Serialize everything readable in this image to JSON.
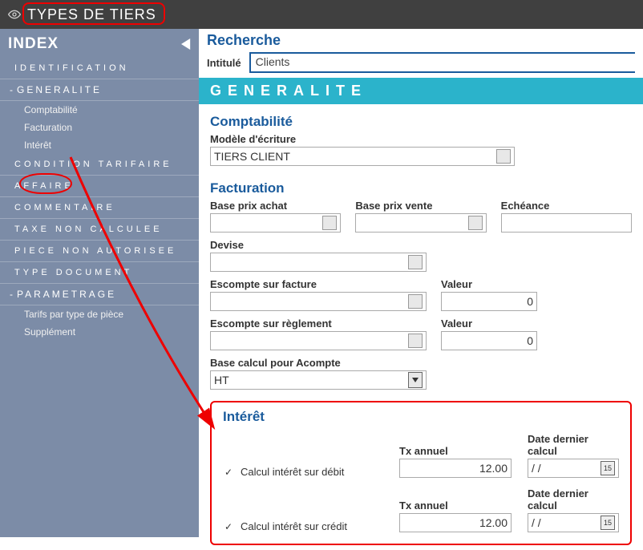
{
  "header": {
    "title": "TYPES DE TIERS"
  },
  "sidebar": {
    "index_label": "INDEX",
    "groups": [
      {
        "label": "IDENTIFICATION"
      }
    ],
    "generalite": {
      "label": "GENERALITE",
      "sub": [
        "Comptabilité",
        "Facturation",
        "Intérêt"
      ]
    },
    "items": [
      "CONDITION TARIFAIRE",
      "AFFAIRE",
      "COMMENTAIRE",
      "TAXE NON CALCULEE",
      "PIECE NON AUTORISEE",
      "TYPE DOCUMENT"
    ],
    "parametrage": {
      "label": "PARAMETRAGE",
      "sub": [
        "Tarifs par type de pièce",
        "Supplément"
      ]
    }
  },
  "search": {
    "heading": "Recherche",
    "label": "Intitulé",
    "value": "Clients"
  },
  "section_title": "GENERALITE",
  "compta": {
    "heading": "Comptabilité",
    "modele_label": "Modèle d'écriture",
    "modele_value": "TIERS CLIENT"
  },
  "fact": {
    "heading": "Facturation",
    "base_achat_label": "Base prix achat",
    "base_achat_value": "",
    "base_vente_label": "Base prix vente",
    "base_vente_value": "",
    "echeance_label": "Echéance",
    "echeance_value": "",
    "devise_label": "Devise",
    "devise_value": "",
    "escompte_facture_label": "Escompte sur facture",
    "escompte_facture_value": "",
    "valeur1_label": "Valeur",
    "valeur1_value": "0",
    "escompte_reglement_label": "Escompte sur règlement",
    "escompte_reglement_value": "",
    "valeur2_label": "Valeur",
    "valeur2_value": "0",
    "base_acompte_label": "Base calcul pour Acompte",
    "base_acompte_value": "HT"
  },
  "interest": {
    "heading": "Intérêt",
    "debit_label": "Calcul intérêt sur débit",
    "credit_label": "Calcul intérêt sur crédit",
    "tx_label": "Tx annuel",
    "tx_debit_value": "12.00",
    "tx_credit_value": "12.00",
    "date_label": "Date dernier calcul",
    "date_placeholder": "/ /"
  }
}
